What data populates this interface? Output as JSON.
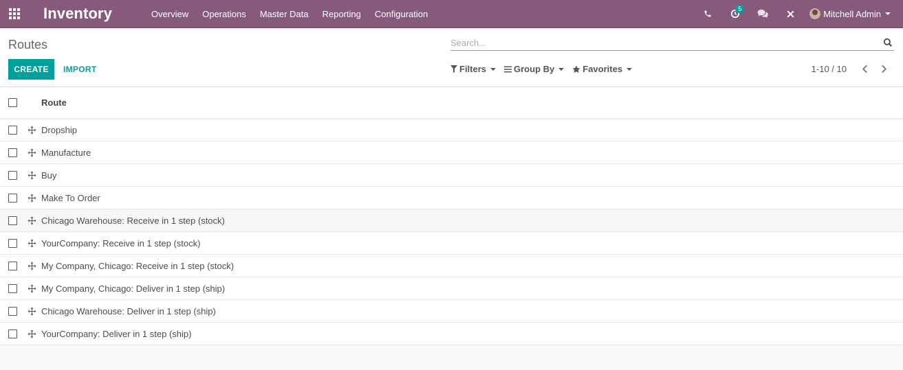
{
  "navbar": {
    "app_name": "Inventory",
    "menu": [
      {
        "label": "Overview"
      },
      {
        "label": "Operations"
      },
      {
        "label": "Master Data"
      },
      {
        "label": "Reporting"
      },
      {
        "label": "Configuration"
      }
    ],
    "activity_count": "5",
    "user_name": "Mitchell Admin",
    "icons": [
      "apps-grid-icon",
      "phone-icon",
      "clock-icon",
      "chat-icon",
      "close-icon",
      "caret-down-icon"
    ]
  },
  "control": {
    "breadcrumb": "Routes",
    "search_placeholder": "Search...",
    "create_label": "CREATE",
    "import_label": "IMPORT",
    "filters_label": "Filters",
    "group_by_label": "Group By",
    "favorites_label": "Favorites",
    "pager": "1-10 / 10"
  },
  "list": {
    "column_route": "Route",
    "rows": [
      {
        "name": "Dropship"
      },
      {
        "name": "Manufacture"
      },
      {
        "name": "Buy"
      },
      {
        "name": "Make To Order"
      },
      {
        "name": "Chicago Warehouse: Receive in 1 step (stock)"
      },
      {
        "name": "YourCompany: Receive in 1 step (stock)"
      },
      {
        "name": "My Company, Chicago: Receive in 1 step (stock)"
      },
      {
        "name": "My Company, Chicago: Deliver in 1 step (ship)"
      },
      {
        "name": "Chicago Warehouse: Deliver in 1 step (ship)"
      },
      {
        "name": "YourCompany: Deliver in 1 step (ship)"
      }
    ]
  },
  "colors": {
    "brand": "#875a7b",
    "accent": "#00a09d"
  }
}
